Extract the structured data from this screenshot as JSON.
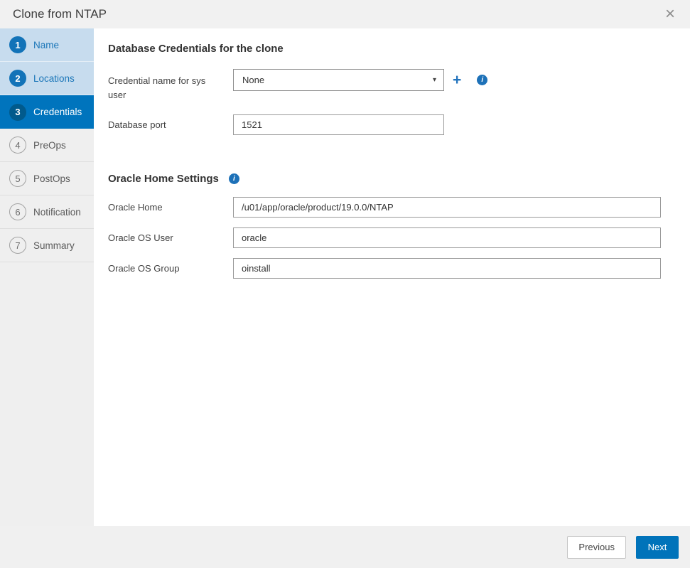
{
  "dialog": {
    "title": "Clone from NTAP"
  },
  "icons": {
    "close": "×",
    "plus": "+",
    "info": "i",
    "caret": "▾"
  },
  "colors": {
    "accent_blue": "#0074bd",
    "step_circle_blue": "#1273b8",
    "active_circle_blue": "#015a8c",
    "done_step_bg": "#c7dcee",
    "info_icon_blue": "#1d71b8",
    "next_button_blue": "#0073ba"
  },
  "wizard_steps": [
    {
      "number": "1",
      "label": "Name",
      "state": "done"
    },
    {
      "number": "2",
      "label": "Locations",
      "state": "done"
    },
    {
      "number": "3",
      "label": "Credentials",
      "state": "active"
    },
    {
      "number": "4",
      "label": "PreOps",
      "state": "todo"
    },
    {
      "number": "5",
      "label": "PostOps",
      "state": "todo"
    },
    {
      "number": "6",
      "label": "Notification",
      "state": "todo"
    },
    {
      "number": "7",
      "label": "Summary",
      "state": "todo"
    }
  ],
  "credentials_section": {
    "heading": "Database Credentials for the clone",
    "credential_label": "Credential name for sys user",
    "credential_value": "None",
    "port_label": "Database port",
    "port_value": "1521"
  },
  "oracle_section": {
    "heading": "Oracle Home Settings",
    "home_label": "Oracle Home",
    "home_value": "/u01/app/oracle/product/19.0.0/NTAP",
    "user_label": "Oracle OS User",
    "user_value": "oracle",
    "group_label": "Oracle OS Group",
    "group_value": "oinstall"
  },
  "footer": {
    "previous_label": "Previous",
    "next_label": "Next"
  }
}
